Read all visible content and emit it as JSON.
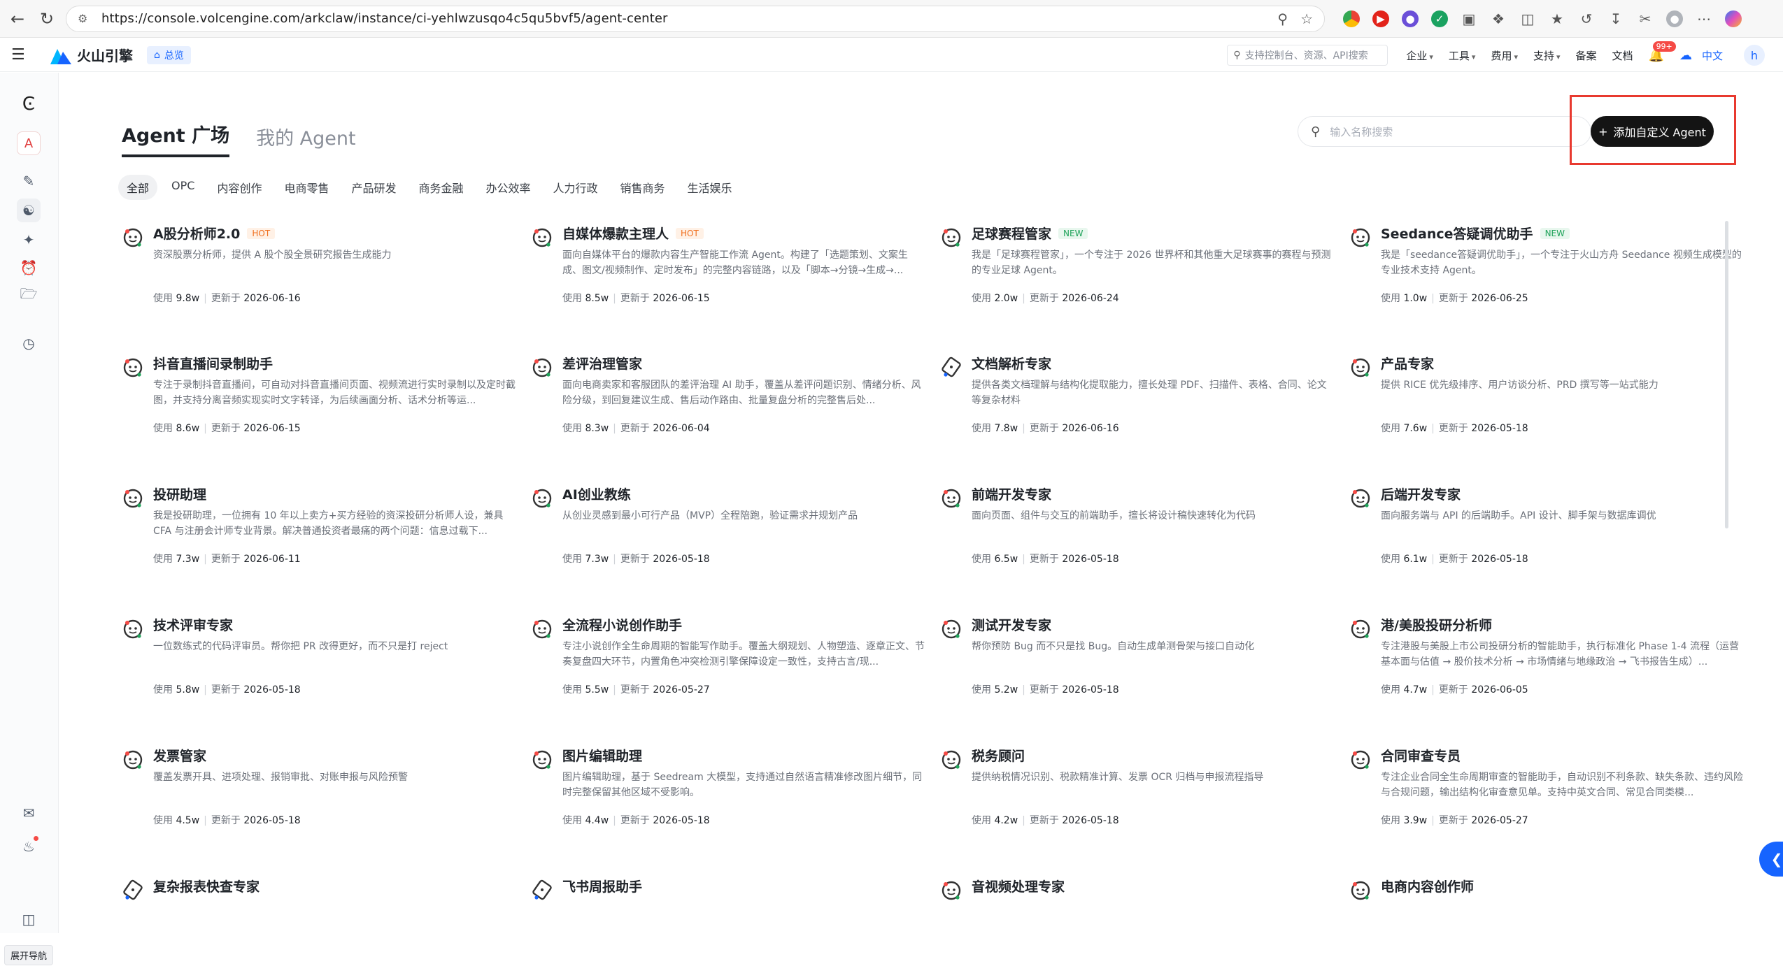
{
  "browser": {
    "url": "https://console.volcengine.com/arkclaw/instance/ci-yehlwzusqo4c5qu5bvf5/agent-center"
  },
  "topbar": {
    "brand": "火山引擎",
    "home_chip": "总览",
    "search_placeholder": "支持控制台、资源、API搜索",
    "menu": [
      "企业",
      "工具",
      "费用",
      "支持"
    ],
    "links": [
      "备案",
      "文档"
    ],
    "notification_badge": "99+",
    "language": "中文",
    "avatar": "h"
  },
  "rail": {
    "avatar_letter": "A",
    "tooltip": "展开导航"
  },
  "page": {
    "tabs": [
      "Agent 广场",
      "我的 Agent"
    ],
    "active_tab": 0,
    "search_placeholder": "输入名称搜索",
    "add_button": "添加自定义 Agent",
    "categories": [
      "全部",
      "OPC",
      "内容创作",
      "电商零售",
      "产品研发",
      "商务金融",
      "办公效率",
      "人力行政",
      "销售商务",
      "生活娱乐"
    ],
    "active_category": 0,
    "usage_prefix": "使用",
    "updated_prefix": "更新于"
  },
  "colors": {
    "accent": "#1664ff",
    "button_dark": "#141414",
    "hot": "#f0701f",
    "new": "#1fa35a",
    "highlight": "#e8392f"
  },
  "agents": [
    {
      "name": "A股分析师2.0",
      "tag": "HOT",
      "tag_type": "hot",
      "desc": "资深股票分析师，提供 A 股个股全景研究报告生成能力",
      "usage": "9.8w",
      "updated": "2026-06-16",
      "icon": "agent-bot-icon"
    },
    {
      "name": "自媒体爆款主理人",
      "tag": "HOT",
      "tag_type": "hot",
      "desc": "面向自媒体平台的爆款内容生产智能工作流 Agent。构建了「选题策划、文案生成、图文/视频制作、定时发布」的完整内容链路，以及「脚本→分镜→生成→...",
      "usage": "8.5w",
      "updated": "2026-06-15",
      "icon": "agent-bot-icon"
    },
    {
      "name": "足球赛程管家",
      "tag": "NEW",
      "tag_type": "new",
      "desc": "我是「足球赛程管家」，一个专注于 2026 世界杯和其他重大足球赛事的赛程与预测的专业足球 Agent。",
      "usage": "2.0w",
      "updated": "2026-06-24",
      "icon": "agent-bot-icon"
    },
    {
      "name": "Seedance答疑调优助手",
      "tag": "NEW",
      "tag_type": "new",
      "desc": "我是「seedance答疑调优助手」，一个专注于火山方舟 Seedance 视频生成模型的专业技术支持 Agent。",
      "usage": "1.0w",
      "updated": "2026-06-25",
      "icon": "agent-bot-icon"
    },
    {
      "name": "抖音直播间录制助手",
      "tag": "",
      "tag_type": "",
      "desc": "专注于录制抖音直播间，可自动对抖音直播间页面、视频流进行实时录制以及定时截图，并支持分离音频实现实时文字转译，为后续画面分析、话术分析等运...",
      "usage": "8.6w",
      "updated": "2026-06-15",
      "icon": "agent-bot-icon"
    },
    {
      "name": "差评治理管家",
      "tag": "",
      "tag_type": "",
      "desc": "面向电商卖家和客服团队的差评治理 AI 助手，覆盖从差评问题识别、情绪分析、风险分级，到回复建议生成、售后动作路由、批量复盘分析的完整售后处...",
      "usage": "8.3w",
      "updated": "2026-06-04",
      "icon": "agent-bot-icon"
    },
    {
      "name": "文档解析专家",
      "tag": "",
      "tag_type": "",
      "desc": "提供各类文档理解与结构化提取能力，擅长处理 PDF、扫描件、表格、合同、论文等复杂材料",
      "usage": "7.8w",
      "updated": "2026-06-16",
      "icon": "agent-pen-icon"
    },
    {
      "name": "产品专家",
      "tag": "",
      "tag_type": "",
      "desc": "提供 RICE 优先级排序、用户访谈分析、PRD 撰写等一站式能力",
      "usage": "7.6w",
      "updated": "2026-05-18",
      "icon": "agent-bot-icon"
    },
    {
      "name": "投研助理",
      "tag": "",
      "tag_type": "",
      "desc": "我是投研助理，一位拥有 10 年以上卖方+买方经验的资深投研分析师人设，兼具 CFA 与注册会计师专业背景。解决普通投资者最痛的两个问题：信息过载下...",
      "usage": "7.3w",
      "updated": "2026-06-11",
      "icon": "agent-bot-icon"
    },
    {
      "name": "AI创业教练",
      "tag": "",
      "tag_type": "",
      "desc": "从创业灵感到最小可行产品（MVP）全程陪跑，验证需求并规划产品",
      "usage": "7.3w",
      "updated": "2026-05-18",
      "icon": "agent-bot-icon"
    },
    {
      "name": "前端开发专家",
      "tag": "",
      "tag_type": "",
      "desc": "面向页面、组件与交互的前端助手，擅长将设计稿快速转化为代码",
      "usage": "6.5w",
      "updated": "2026-05-18",
      "icon": "agent-bot-icon"
    },
    {
      "name": "后端开发专家",
      "tag": "",
      "tag_type": "",
      "desc": "面向服务端与 API 的后端助手。API 设计、脚手架与数据库调优",
      "usage": "6.1w",
      "updated": "2026-05-18",
      "icon": "agent-bot-icon"
    },
    {
      "name": "技术评审专家",
      "tag": "",
      "tag_type": "",
      "desc": "一位数练式的代码评审员。帮你把 PR 改得更好，而不只是打 reject",
      "usage": "5.8w",
      "updated": "2026-05-18",
      "icon": "agent-bot-icon"
    },
    {
      "name": "全流程小说创作助手",
      "tag": "",
      "tag_type": "",
      "desc": "专注小说创作全生命周期的智能写作助手。覆盖大纲规划、人物塑造、逐章正文、节奏复盘四大环节，内置角色冲突检测引擎保障设定一致性，支持古言/现...",
      "usage": "5.5w",
      "updated": "2026-05-27",
      "icon": "agent-bot-icon"
    },
    {
      "name": "测试开发专家",
      "tag": "",
      "tag_type": "",
      "desc": "帮你预防 Bug 而不只是找 Bug。自动生成单测骨架与接口自动化",
      "usage": "5.2w",
      "updated": "2026-05-18",
      "icon": "agent-bot-icon"
    },
    {
      "name": "港/美股投研分析师",
      "tag": "",
      "tag_type": "",
      "desc": "专注港股与美股上市公司投研分析的智能助手，执行标准化 Phase 1-4 流程（运营基本面与估值 → 股价技术分析 → 市场情绪与地缘政治 → 飞书报告生成）...",
      "usage": "4.7w",
      "updated": "2026-06-05",
      "icon": "agent-bot-icon"
    },
    {
      "name": "发票管家",
      "tag": "",
      "tag_type": "",
      "desc": "覆盖发票开具、进项处理、报销审批、对账申报与风险预警",
      "usage": "4.5w",
      "updated": "2026-05-18",
      "icon": "agent-bot-icon"
    },
    {
      "name": "图片编辑助理",
      "tag": "",
      "tag_type": "",
      "desc": "图片编辑助理，基于 Seedream 大模型，支持通过自然语言精准修改图片细节，同时完整保留其他区域不受影响。",
      "usage": "4.4w",
      "updated": "2026-05-18",
      "icon": "agent-bot-icon"
    },
    {
      "name": "税务顾问",
      "tag": "",
      "tag_type": "",
      "desc": "提供纳税情况识别、税款精准计算、发票 OCR 归档与申报流程指导",
      "usage": "4.2w",
      "updated": "2026-05-18",
      "icon": "agent-bot-icon"
    },
    {
      "name": "合同审查专员",
      "tag": "",
      "tag_type": "",
      "desc": "专注企业合同全生命周期审查的智能助手，自动识别不利条款、缺失条款、违约风险与合规问题，输出结构化审查意见单。支持中英文合同、常见合同类模...",
      "usage": "3.9w",
      "updated": "2026-05-27",
      "icon": "agent-bot-icon"
    },
    {
      "name": "复杂报表快查专家",
      "tag": "",
      "tag_type": "",
      "desc": "",
      "usage": "",
      "updated": "",
      "icon": "agent-pen-icon"
    },
    {
      "name": "飞书周报助手",
      "tag": "",
      "tag_type": "",
      "desc": "",
      "usage": "",
      "updated": "",
      "icon": "agent-pen-icon"
    },
    {
      "name": "音视频处理专家",
      "tag": "",
      "tag_type": "",
      "desc": "",
      "usage": "",
      "updated": "",
      "icon": "agent-bot-icon"
    },
    {
      "name": "电商内容创作师",
      "tag": "",
      "tag_type": "",
      "desc": "",
      "usage": "",
      "updated": "",
      "icon": "agent-bot-icon"
    }
  ]
}
